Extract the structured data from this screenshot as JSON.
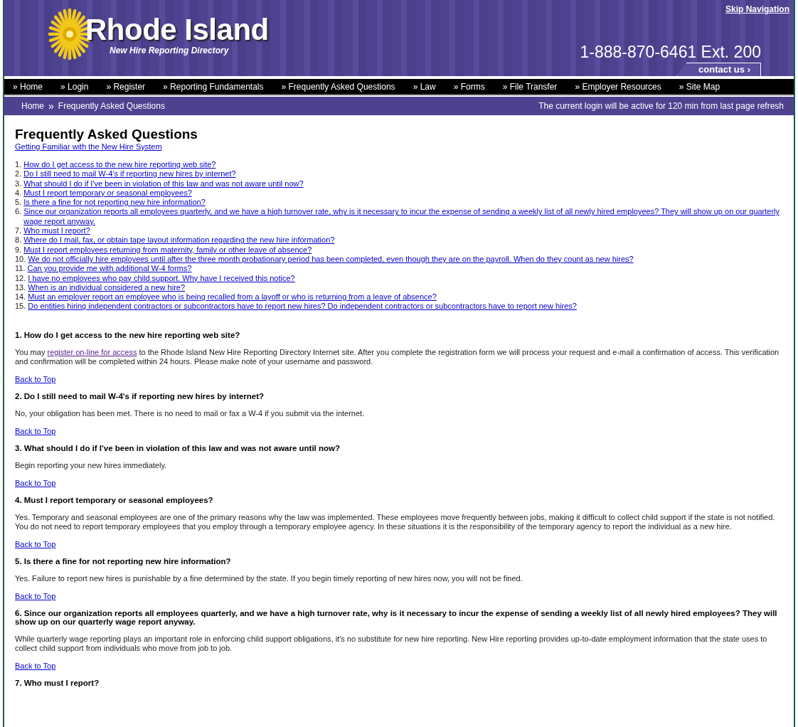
{
  "header": {
    "skip_link": "Skip Navigation",
    "logo_title": "Rhode Island",
    "logo_subtitle": "New Hire Reporting Directory",
    "phone": "1-888-870-6461 Ext. 200",
    "contact": "contact us ›"
  },
  "nav": [
    "» Home",
    "» Login",
    "» Register",
    "» Reporting Fundamentals",
    "» Frequently Asked Questions",
    "» Law",
    "» Forms",
    "» File Transfer",
    "» Employer Resources",
    "» Site Map"
  ],
  "breadcrumb": {
    "items": [
      "Home",
      "Frequently Asked Questions"
    ],
    "separator": "»",
    "session_note": "The current login will be active for 120 min from last page refresh"
  },
  "page_title": "Frequently Asked Questions",
  "intro_link": "Getting Familiar with the New Hire System",
  "toc": [
    {
      "number": "1.",
      "text": "How do I get access to the new hire reporting web site?"
    },
    {
      "number": "2.",
      "text": "Do I still need to mail W-4's if reporting new hires by internet?"
    },
    {
      "number": "3.",
      "text": "What should I do if I've been in violation of this law and was not aware until now?"
    },
    {
      "number": "4.",
      "text": "Must I report temporary or seasonal employees?"
    },
    {
      "number": "5.",
      "text": "Is there a fine for not reporting new hire information?"
    },
    {
      "number": "6.",
      "text": "Since our organization reports all employees quarterly, and we have a high turnover rate, why is it necessary to incur the expense of sending a weekly list of all newly hired employees? They will show up on our quarterly wage report anyway."
    },
    {
      "number": "7.",
      "text": "Who must I report?"
    },
    {
      "number": "8.",
      "text": "Where do I mail, fax, or obtain tape layout information regarding the new hire information?"
    },
    {
      "number": "9.",
      "text": "Must I report employees returning from maternity, family or other leave of absence?"
    },
    {
      "number": "10.",
      "text": "We do not officially hire employees until after the three month probationary period has been completed, even though they are on the payroll. When do they count as new hires?"
    },
    {
      "number": "11.",
      "text": "Can you provide me with additional W-4 forms?"
    },
    {
      "number": "12.",
      "text": "I have no employees who pay child support. Why have I received this notice?"
    },
    {
      "number": "13.",
      "text": "When is an individual considered a new hire?"
    },
    {
      "number": "14.",
      "text": "Must an employer report an employee who is being recalled from a layoff or who is returning from a leave of absence?"
    },
    {
      "number": "15.",
      "text": "Do entities hiring independent contractors or subcontractors have to report new hires? Do independent contractors or subcontractors have to report new hires?"
    }
  ],
  "answers": [
    {
      "question": "1. How do I get access to the new hire reporting web site?",
      "answer": [
        {
          "kind": "text",
          "text": "You may "
        },
        {
          "kind": "visited_link",
          "text": "register on-line for access"
        },
        {
          "kind": "text",
          "text": " to the Rhode Island New Hire Reporting Directory Internet site. After you complete the registration form we will process your request and e-mail a confirmation of access. This verification and confirmation will be completed within 24 hours. Please make note of your username and password."
        }
      ],
      "back": "Back to Top"
    },
    {
      "question": "2. Do I still need to mail W-4's if reporting new hires by internet?",
      "answer": [
        {
          "kind": "text",
          "text": "No, your obligation has been met. There is no need to mail or fax a W-4 if you submit via the internet."
        }
      ],
      "back": "Back to Top"
    },
    {
      "question": "3. What should I do if I've been in violation of this law and was not aware until now?",
      "answer": [
        {
          "kind": "text",
          "text": "Begin reporting your new hires immediately."
        }
      ],
      "back": "Back to Top"
    },
    {
      "question": "4. Must I report temporary or seasonal employees?",
      "answer": [
        {
          "kind": "text",
          "text": "Yes. Temporary and seasonal employees are one of the primary reasons why the law was implemented. These employees move frequently between jobs, making it difficult to collect child support if the state is not notified. You do not need to report temporary employees that you employ through a temporary employee agency. In these situations it is the responsibility of the temporary agency to report the individual as a new hire."
        }
      ],
      "back": "Back to Top"
    },
    {
      "question": "5. Is there a fine for not reporting new hire information?",
      "answer": [
        {
          "kind": "text",
          "text": "Yes. Failure to report new hires is punishable by a fine determined by the state. If you begin timely reporting of new hires now, you will not be fined."
        }
      ],
      "back": "Back to Top"
    },
    {
      "question": "6. Since our organization reports all employees quarterly, and we have a high turnover rate, why is it necessary to incur the expense of sending a weekly list of all newly hired employees? They will show up on our quarterly wage report anyway.",
      "answer": [
        {
          "kind": "text",
          "text": "While quarterly wage reporting plays an important role in enforcing child support obligations, it's no substitute for new hire reporting. New Hire reporting provides up-to-date employment information that the state uses to collect child support from individuals who move from job to job."
        }
      ],
      "back": "Back to Top"
    },
    {
      "question": "7. Who must I report?"
    }
  ]
}
